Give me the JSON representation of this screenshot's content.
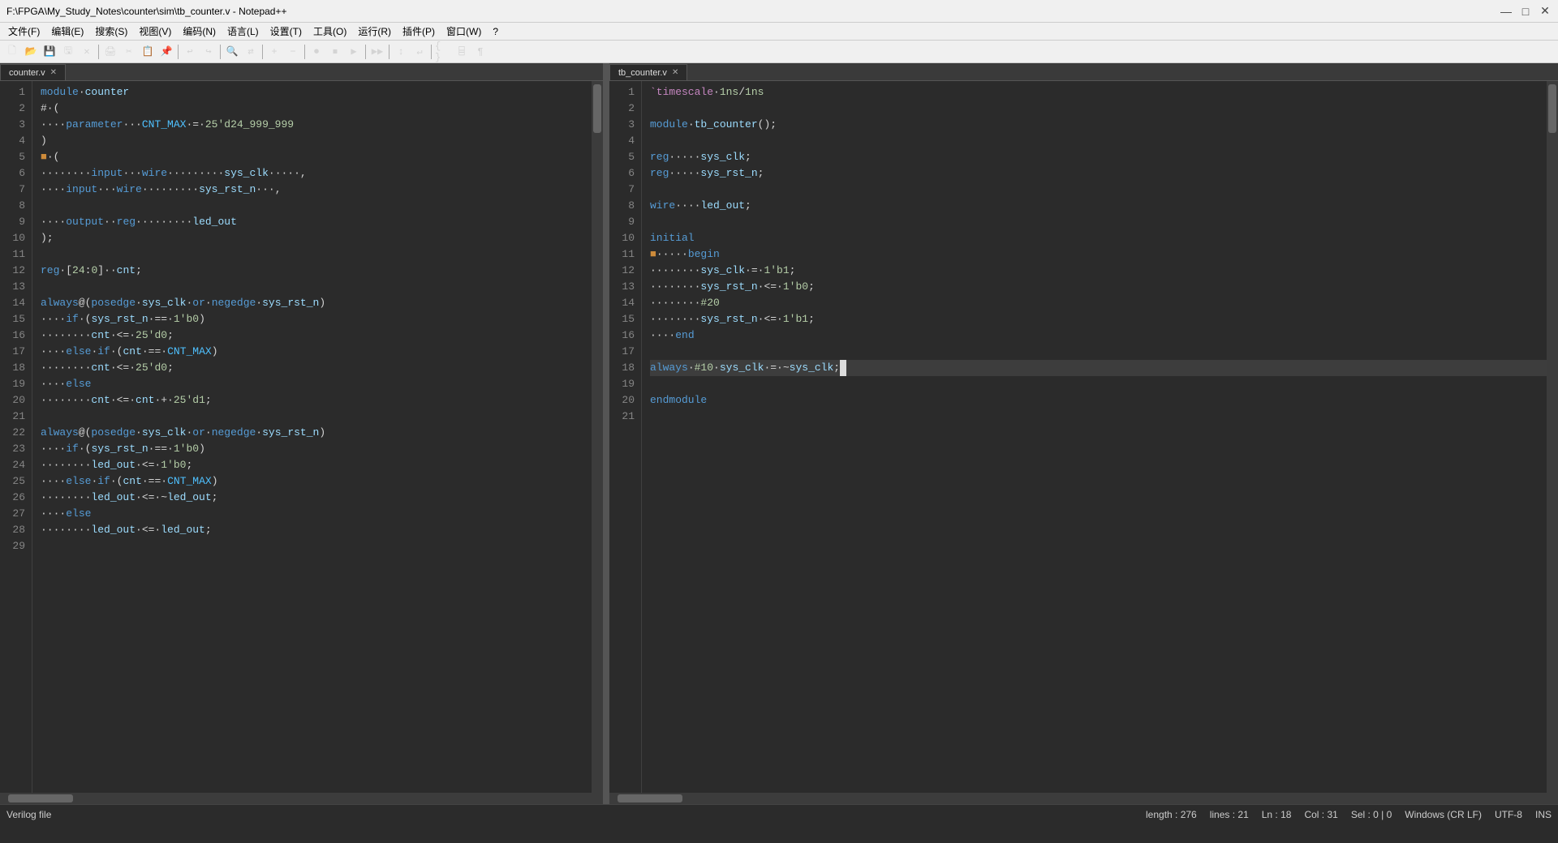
{
  "window": {
    "title": "F:\\FPGA\\My_Study_Notes\\counter\\sim\\tb_counter.v - Notepad++",
    "controls": [
      "—",
      "□",
      "✕"
    ]
  },
  "menu": {
    "items": [
      "文件(F)",
      "编辑(E)",
      "搜索(S)",
      "视图(V)",
      "编码(N)",
      "语言(L)",
      "设置(T)",
      "工具(O)",
      "运行(R)",
      "插件(P)",
      "窗口(W)",
      "?"
    ]
  },
  "tabs": {
    "left": {
      "label": "counter.v",
      "active": true
    },
    "right": {
      "label": "tb_counter.v",
      "active": true
    }
  },
  "status": {
    "file_type": "Verilog file",
    "length": "length : 276",
    "lines": "lines : 21",
    "ln": "Ln : 18",
    "col": "Col : 31",
    "sel": "Sel : 0 | 0",
    "line_ending": "Windows (CR LF)",
    "encoding": "UTF-8",
    "ins": "INS"
  },
  "left_code": {
    "lines": [
      {
        "num": 1,
        "content": "module·counter"
      },
      {
        "num": 2,
        "content": "#·("
      },
      {
        "num": 3,
        "content": "····parameter···CNT_MAX·=·25'd24_999_999"
      },
      {
        "num": 4,
        "content": ")"
      },
      {
        "num": 5,
        "content": "■·("
      },
      {
        "num": 6,
        "content": "········input···wire·········sys_clk·····,"
      },
      {
        "num": 7,
        "content": "····input···wire·········sys_rst_n···,"
      },
      {
        "num": 8,
        "content": ""
      },
      {
        "num": 9,
        "content": "····output··reg·········led_out"
      },
      {
        "num": 10,
        "content": ");"
      },
      {
        "num": 11,
        "content": ""
      },
      {
        "num": 12,
        "content": "reg·[24:0]··cnt;"
      },
      {
        "num": 13,
        "content": ""
      },
      {
        "num": 14,
        "content": "always@(posedge·sys_clk·or·negedge·sys_rst_n)"
      },
      {
        "num": 15,
        "content": "····if·(sys_rst_n·==·1'b0)"
      },
      {
        "num": 16,
        "content": "········cnt·<=·25'd0;"
      },
      {
        "num": 17,
        "content": "····else·if·(cnt·==·CNT_MAX)"
      },
      {
        "num": 18,
        "content": "········cnt·<=·25'd0;"
      },
      {
        "num": 19,
        "content": "····else"
      },
      {
        "num": 20,
        "content": "········cnt·<=·cnt·+·25'd1;"
      },
      {
        "num": 21,
        "content": ""
      },
      {
        "num": 22,
        "content": "always@(posedge·sys_clk·or·negedge·sys_rst_n)"
      },
      {
        "num": 23,
        "content": "····if·(sys_rst_n·==·1'b0)"
      },
      {
        "num": 24,
        "content": "········led_out·<=·1'b0;"
      },
      {
        "num": 25,
        "content": "····else·if·(cnt·==·CNT_MAX)"
      },
      {
        "num": 26,
        "content": "········led_out·<=·~led_out;"
      },
      {
        "num": 27,
        "content": "····else"
      },
      {
        "num": 28,
        "content": "········led_out·<=·led_out;"
      },
      {
        "num": 29,
        "content": ""
      }
    ]
  },
  "right_code": {
    "lines": [
      {
        "num": 1,
        "content": "`timescale·1ns/1ns"
      },
      {
        "num": 2,
        "content": ""
      },
      {
        "num": 3,
        "content": "module·tb_counter();"
      },
      {
        "num": 4,
        "content": ""
      },
      {
        "num": 5,
        "content": "reg·····sys_clk;"
      },
      {
        "num": 6,
        "content": "reg·····sys_rst_n;"
      },
      {
        "num": 7,
        "content": ""
      },
      {
        "num": 8,
        "content": "wire····led_out;"
      },
      {
        "num": 9,
        "content": ""
      },
      {
        "num": 10,
        "content": "initial"
      },
      {
        "num": 11,
        "content": "■·····begin"
      },
      {
        "num": 12,
        "content": "········sys_clk·=·1'b1;"
      },
      {
        "num": 13,
        "content": "········sys_rst_n·<=·1'b0;"
      },
      {
        "num": 14,
        "content": "········#20"
      },
      {
        "num": 15,
        "content": "········sys_rst_n·<=·1'b1;"
      },
      {
        "num": 16,
        "content": "····end"
      },
      {
        "num": 17,
        "content": ""
      },
      {
        "num": 18,
        "content": "always·#10·sys_clk·=·~sys_clk;"
      },
      {
        "num": 19,
        "content": ""
      },
      {
        "num": 20,
        "content": "endmodule"
      },
      {
        "num": 21,
        "content": ""
      }
    ]
  }
}
